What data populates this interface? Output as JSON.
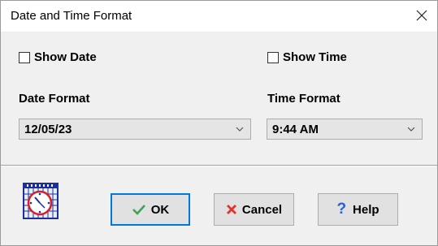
{
  "window": {
    "title": "Date and Time Format"
  },
  "options": {
    "show_date_label": "Show Date",
    "show_date_checked": false,
    "show_time_label": "Show Time",
    "show_time_checked": false
  },
  "date_format": {
    "label": "Date Format",
    "selected": "12/05/23"
  },
  "time_format": {
    "label": "Time Format",
    "selected": "9:44 AM"
  },
  "buttons": {
    "ok": "OK",
    "cancel": "Cancel",
    "help": "Help"
  },
  "icons": {
    "close": "close-icon",
    "calendar_clock": "calendar-clock-icon",
    "ok": "checkmark-icon",
    "cancel": "x-icon",
    "help": "question-mark-icon",
    "dropdown": "chevron-down-icon"
  },
  "colors": {
    "dialog_bg": "#f0f0f0",
    "default_button_border": "#0078d7",
    "ok_check": "#3aa655",
    "cancel_x": "#e0352b",
    "help_mark": "#2a5fd6"
  }
}
